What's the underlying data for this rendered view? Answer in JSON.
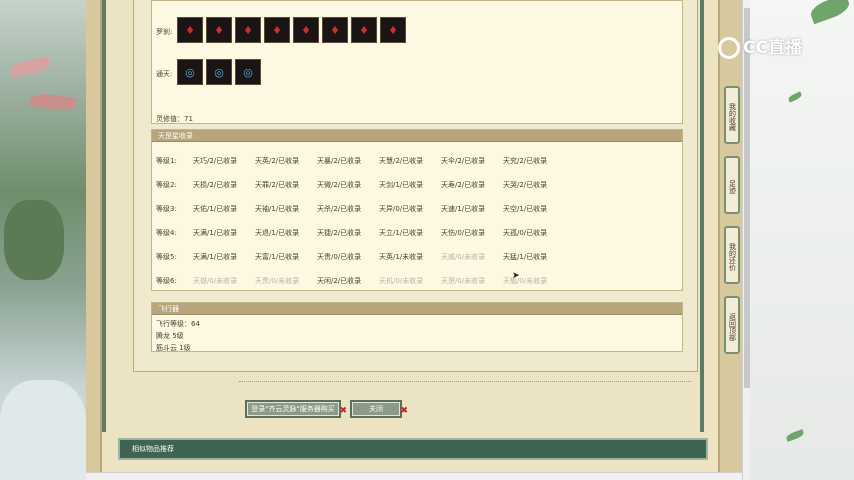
{
  "artifact_rows": [
    {
      "label": "罗刹:",
      "icons": [
        "red-artifact-icon",
        "red-artifact-icon",
        "red-artifact-icon",
        "red-artifact-icon",
        "red-artifact-icon",
        "red-artifact-icon",
        "red-artifact-icon",
        "red-artifact-icon"
      ],
      "icon_color": "#c63030"
    },
    {
      "label": "通天:",
      "icons": [
        "blue-ring-icon",
        "blue-ring-icon",
        "blue-ring-icon"
      ],
      "icon_color": "#52b3d0"
    }
  ],
  "spirit_value": "灵修值：71",
  "collection": {
    "title": "天罡星收录",
    "rows": [
      {
        "level": "等级1:",
        "cells": [
          {
            "t": "天巧/2/已收录",
            "dim": false
          },
          {
            "t": "天英/2/已收录",
            "dim": false
          },
          {
            "t": "天暴/2/已收录",
            "dim": false
          },
          {
            "t": "天慧/2/已收录",
            "dim": false
          },
          {
            "t": "天伞/2/已收录",
            "dim": false
          },
          {
            "t": "天究/2/已收录",
            "dim": false
          }
        ]
      },
      {
        "level": "等级2:",
        "cells": [
          {
            "t": "天损/2/已收录",
            "dim": false
          },
          {
            "t": "天罪/2/已收录",
            "dim": false
          },
          {
            "t": "天微/2/已收录",
            "dim": false
          },
          {
            "t": "天剑/1/已收录",
            "dim": false
          },
          {
            "t": "天寿/2/已收录",
            "dim": false
          },
          {
            "t": "天哭/2/已收录",
            "dim": false
          }
        ]
      },
      {
        "level": "等级3:",
        "cells": [
          {
            "t": "天佑/1/已收录",
            "dim": false
          },
          {
            "t": "天袖/1/已收录",
            "dim": false
          },
          {
            "t": "天杀/2/已收录",
            "dim": false
          },
          {
            "t": "天异/0/已收录",
            "dim": false
          },
          {
            "t": "天速/1/已收录",
            "dim": false
          },
          {
            "t": "天空/1/已收录",
            "dim": false
          }
        ]
      },
      {
        "level": "等级4:",
        "cells": [
          {
            "t": "天满/1/已收录",
            "dim": false
          },
          {
            "t": "天退/1/已收录",
            "dim": false
          },
          {
            "t": "天捷/2/已收录",
            "dim": false
          },
          {
            "t": "天立/1/已收录",
            "dim": false
          },
          {
            "t": "天伤/0/已收录",
            "dim": false
          },
          {
            "t": "天孤/0/已收录",
            "dim": false
          }
        ]
      },
      {
        "level": "等级5:",
        "cells": [
          {
            "t": "天满/1/已收录",
            "dim": false
          },
          {
            "t": "天富/1/已收录",
            "dim": false
          },
          {
            "t": "天贵/0/已收录",
            "dim": false
          },
          {
            "t": "天英/1/未收录",
            "dim": false
          },
          {
            "t": "天威/0/未收录",
            "dim": true
          },
          {
            "t": "天猛/1/已收录",
            "dim": false
          }
        ]
      },
      {
        "level": "等级6:",
        "cells": [
          {
            "t": "天雄/0/未收录",
            "dim": true
          },
          {
            "t": "天贵/0/未收录",
            "dim": true
          },
          {
            "t": "天闲/2/已收录",
            "dim": false
          },
          {
            "t": "天机/0/未收录",
            "dim": true
          },
          {
            "t": "天罡/0/未收录",
            "dim": true
          },
          {
            "t": "天魁/0/未收录",
            "dim": true
          }
        ]
      }
    ]
  },
  "flight": {
    "title": "飞行器",
    "lines": [
      "飞行等级：64",
      "腾龙  5级",
      "筋斗云  1级"
    ]
  },
  "buttons": {
    "login": "登录\"齐云灵脉\"服务器购买",
    "close": "关闭"
  },
  "bottom_bar_title": "相似物品推荐",
  "side_tabs": [
    "我的收藏",
    "足迹",
    "我的还价",
    "返回顶部"
  ],
  "logo_text": "CC直播"
}
